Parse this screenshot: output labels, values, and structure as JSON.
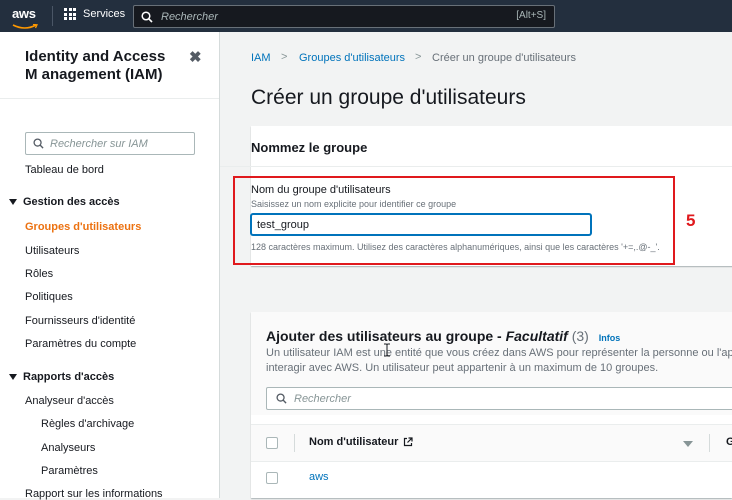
{
  "topbar": {
    "logo_text": "aws",
    "services_label": "Services",
    "search_placeholder": "Rechercher",
    "search_shortcut": "[Alt+S]"
  },
  "sidebar": {
    "title": "Identity and Access M anagement (IAM)",
    "close_icon": "close-icon",
    "search_placeholder": "Rechercher sur IAM",
    "dashboard": "Tableau de bord",
    "access_mgmt": {
      "title": "Gestion des accès",
      "items": [
        "Groupes d'utilisateurs",
        "Utilisateurs",
        "Rôles",
        "Politiques",
        "Fournisseurs d'identité",
        "Paramètres du compte"
      ],
      "active_index": 0
    },
    "access_reports": {
      "title": "Rapports d'accès",
      "items": [
        "Analyseur d'accès"
      ],
      "subitems": [
        "Règles d'archivage",
        "Analyseurs",
        "Paramètres"
      ],
      "cut_item": "Rapport sur les informations"
    }
  },
  "breadcrumb": {
    "items": [
      "IAM",
      "Groupes d'utilisateurs",
      "Créer un groupe d'utilisateurs"
    ],
    "separator": ">"
  },
  "page": {
    "title": "Créer un groupe d'utilisateurs"
  },
  "name_section": {
    "title": "Nommez le groupe",
    "field_label": "Nom du groupe d'utilisateurs",
    "field_description": "Saisissez un nom explicite pour identifier ce groupe",
    "field_value": "test_group",
    "field_help": "128 caractères maximum. Utilisez des caractères alphanumériques, ainsi que les caractères '+=,.@-_'."
  },
  "annotation": {
    "step_number": "5",
    "color": "#e0191d"
  },
  "users_section": {
    "title": "Ajouter des utilisateurs au groupe -",
    "optional": "Facultatif",
    "count": "(3)",
    "info_link": "Infos",
    "description_line1": "Un utilisateur IAM est une entité que vous créez dans AWS pour représenter la personne ou l'app",
    "description_line2": "interagir avec AWS. Un utilisateur peut appartenir à un maximum de 10 groupes.",
    "search_placeholder": "Rechercher",
    "columns": [
      "Nom d'utilisateur",
      "G"
    ],
    "rows": [
      {
        "name": "aws"
      }
    ]
  },
  "colors": {
    "topbar": "#232f3e",
    "link": "#0073bb",
    "active_nav": "#ec7211",
    "background": "#f2f3f3"
  }
}
